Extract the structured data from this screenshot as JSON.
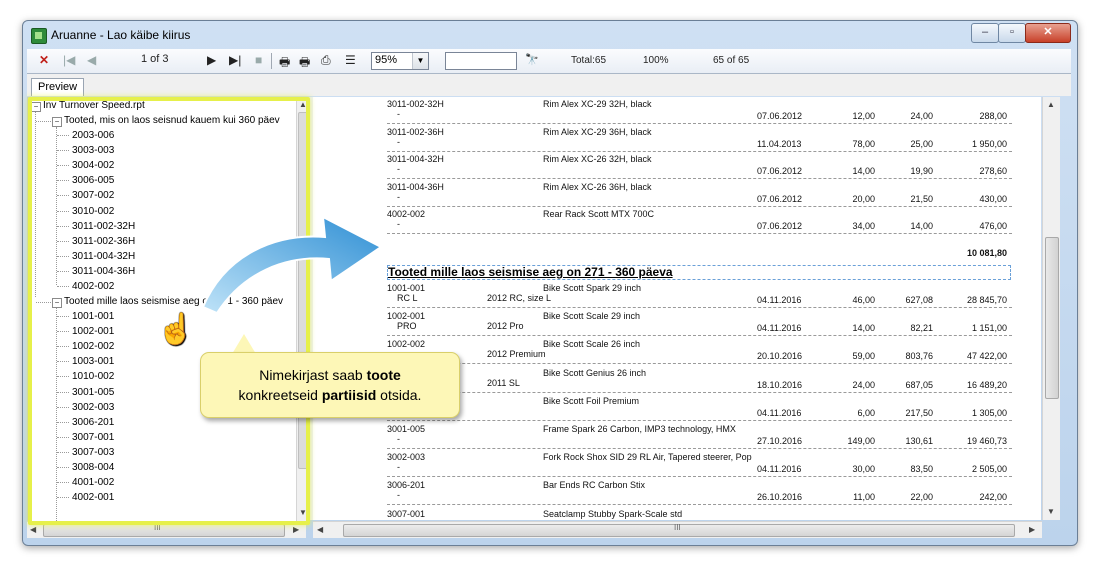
{
  "window": {
    "title": "Aruanne - Lao käibe kiirus",
    "min_label": "–",
    "max_label": "▫",
    "close_label": "✕"
  },
  "toolbar": {
    "close_icon": "✕",
    "first_icon": "|◀",
    "prev_icon": "◀",
    "page_info": "1 of 3",
    "next_icon": "▶",
    "last_icon": "▶|",
    "stop_icon": "■",
    "zoom_value": "95%",
    "zoom_drop": "▼",
    "search_value": "",
    "binoculars_icon": "🔭",
    "total": "Total:65",
    "percent": "100%",
    "count": "65 of 65"
  },
  "tabs": {
    "preview": "Preview"
  },
  "tree": {
    "root": "Inv Turnover Speed.rpt",
    "group1": "Tooted, mis on laos seisnud kauem kui 360 päev",
    "group1_items": [
      "2003-006",
      "3003-003",
      "3004-002",
      "3006-005",
      "3007-002",
      "3010-002",
      "3011-002-32H",
      "3011-002-36H",
      "3011-004-32H",
      "3011-004-36H",
      "4002-002"
    ],
    "group2": "Tooted mille laos seismise aeg on 271 - 360 päev",
    "group2_items": [
      "1001-001",
      "1002-001",
      "1002-002",
      "1003-001",
      "1010-002",
      "3001-005",
      "3002-003",
      "3006-201",
      "3007-001",
      "3007-003",
      "3008-004",
      "4001-002",
      "4002-001"
    ],
    "hscroll_grip": "III"
  },
  "report": {
    "rows_top": [
      {
        "code": "3011-002-32H",
        "name": "Rim Alex XC-29 32H, black",
        "sub": "-",
        "date": "07.06.2012",
        "qty": "12,00",
        "price": "24,00",
        "sum": "288,00"
      },
      {
        "code": "3011-002-36H",
        "name": "Rim Alex XC-29 36H, black",
        "sub": "-",
        "date": "11.04.2013",
        "qty": "78,00",
        "price": "25,00",
        "sum": "1 950,00"
      },
      {
        "code": "3011-004-32H",
        "name": "Rim Alex XC-26 32H, black",
        "sub": "-",
        "date": "07.06.2012",
        "qty": "14,00",
        "price": "19,90",
        "sum": "278,60"
      },
      {
        "code": "3011-004-36H",
        "name": "Rim Alex XC-26 36H, black",
        "sub": "-",
        "date": "07.06.2012",
        "qty": "20,00",
        "price": "21,50",
        "sum": "430,00"
      },
      {
        "code": "4002-002",
        "name": "Rear Rack Scott MTX 700C",
        "sub": "-",
        "date": "07.06.2012",
        "qty": "34,00",
        "price": "14,00",
        "sum": "476,00"
      }
    ],
    "subtotal": "10 081,80",
    "section_title": "Tooted mille laos seismise aeg on 271 - 360 päeva",
    "rows_bottom": [
      {
        "code": "1001-001",
        "name": "Bike Scott Spark 29 inch",
        "sub": "RC L",
        "batch": "2012 RC, size L",
        "date": "04.11.2016",
        "qty": "46,00",
        "price": "627,08",
        "sum": "28 845,70"
      },
      {
        "code": "1002-001",
        "name": "Bike Scott Scale 29 inch",
        "sub": "PRO",
        "batch": "2012 Pro",
        "date": "04.11.2016",
        "qty": "14,00",
        "price": "82,21",
        "sum": "1 151,00"
      },
      {
        "code": "1002-002",
        "name": "Bike Scott Scale 26 inch",
        "sub": "",
        "batch": "2012 Premium",
        "date": "20.10.2016",
        "qty": "59,00",
        "price": "803,76",
        "sum": "47 422,00"
      },
      {
        "code": "",
        "name": "Bike Scott Genius 26 inch",
        "sub": "",
        "batch": "2011 SL",
        "date": "18.10.2016",
        "qty": "24,00",
        "price": "687,05",
        "sum": "16 489,20"
      },
      {
        "code": "",
        "name": "Bike Scott Foil Premium",
        "sub": "",
        "batch": "",
        "date": "04.11.2016",
        "qty": "6,00",
        "price": "217,50",
        "sum": "1 305,00"
      },
      {
        "code": "3001-005",
        "name": "Frame Spark 26 Carbon, IMP3 technology, HMX",
        "sub": "-",
        "batch": "",
        "date": "27.10.2016",
        "qty": "149,00",
        "price": "130,61",
        "sum": "19 460,73"
      },
      {
        "code": "3002-003",
        "name": "Fork Rock Shox SID 29 RL Air, Tapered steerer, Pop",
        "sub": "-",
        "batch": "",
        "date": "04.11.2016",
        "qty": "30,00",
        "price": "83,50",
        "sum": "2 505,00"
      },
      {
        "code": "3006-201",
        "name": "Bar Ends RC Carbon Stix",
        "sub": "-",
        "batch": "",
        "date": "26.10.2016",
        "qty": "11,00",
        "price": "22,00",
        "sum": "242,00"
      },
      {
        "code": "3007-001",
        "name": "Seatclamp Stubby Spark-Scale std",
        "sub": "",
        "batch": "",
        "date": "",
        "qty": "",
        "price": "",
        "sum": ""
      }
    ],
    "hscroll_grip": "III"
  },
  "callout": {
    "line1_pre": "Nimekirjast saab ",
    "line1_bold": "toote",
    "line2_pre": "konkreetseid ",
    "line2_bold": "partiisid",
    "line2_post": " otsida."
  },
  "colors": {
    "highlight": "#e6f04a",
    "callout_bg": "#fdf7b7",
    "arrow": "#3b9ad9"
  }
}
